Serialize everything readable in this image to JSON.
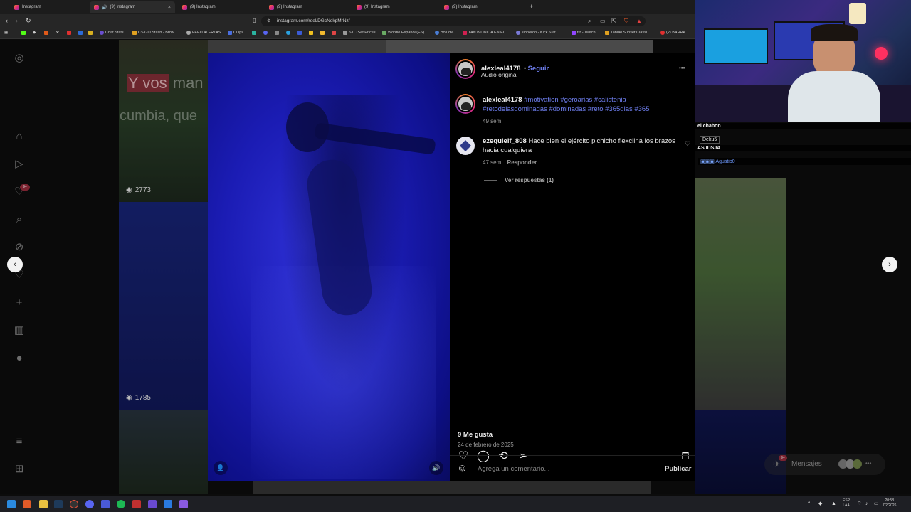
{
  "browser": {
    "tabs": [
      {
        "label": "Instagram",
        "active": false
      },
      {
        "label": "(9) Instagram",
        "active": true
      },
      {
        "label": "(9) Instagram",
        "active": false
      },
      {
        "label": "(9) Instagram",
        "active": false
      },
      {
        "label": "(9) Instagram",
        "active": false
      },
      {
        "label": "(9) Instagram",
        "active": false
      }
    ],
    "new_tab": "+",
    "close": "×",
    "url": "instagram.com/reel/DGcNokpMrNz/",
    "bookmarks": [
      "Chat Stats",
      "CS:GO Stash - Brow...",
      "FEED ALERTAS",
      "CLips",
      "STC Set Prices",
      "Wordle Español (ES)",
      "Boludle",
      "TAN BIONICA EN EL...",
      "sioneron - Kick Stat...",
      "trr - Twitch",
      "Tanuki Sunset Classi...",
      "(2) BARRA"
    ]
  },
  "sidebar": {
    "notif_badge": "9+"
  },
  "grid": {
    "overlay_text_1_highlight": "Y vos",
    "overlay_text_1_rest": " man",
    "overlay_text_2": "cumbia, que",
    "views_1": "2773",
    "views_2": "1785"
  },
  "post": {
    "author": "alexleal4178",
    "follow": "Seguir",
    "audio": "Audio original",
    "more": "•••",
    "caption_author": "alexleal4178",
    "caption_tags_line1": "#motivation #geroarias #calistenia",
    "caption_tags_line2": "#retodelasdominadas #dominadas #reto #365dias #365",
    "caption_age": "49 sem",
    "comment": {
      "author": "ezequielf_808",
      "text": "Hace bien el ejército pichicho flexciina los brazos hacia cualquiera",
      "age": "47 sem",
      "reply": "Responder",
      "view_replies": "Ver respuestas (1)"
    },
    "likes": "9 Me gusta",
    "date": "24 de febrero de 2025",
    "comment_placeholder": "Agrega un comentario...",
    "publish": "Publicar"
  },
  "stream_chat": [
    {
      "user": "el chabon"
    },
    {
      "user": "Deku5"
    },
    {
      "user": "ASJDSJA"
    },
    {
      "user": "Agustip0"
    }
  ],
  "messages": {
    "label": "Mensajes",
    "badge": "9+"
  },
  "taskbar": {
    "lang_1": "ESP",
    "lang_2": "LAA",
    "time": "20:58",
    "date": "7/2/2026"
  },
  "icons": [
    "instagram-icon",
    "home-icon",
    "reels-icon",
    "heart-icon",
    "search-icon",
    "explore-icon",
    "plus-icon",
    "insights-icon",
    "menu-icon",
    "apps-icon",
    "like-icon",
    "comment-icon",
    "repost-icon",
    "share-icon",
    "save-icon",
    "emoji-icon",
    "volume-icon",
    "user-tag-icon"
  ]
}
